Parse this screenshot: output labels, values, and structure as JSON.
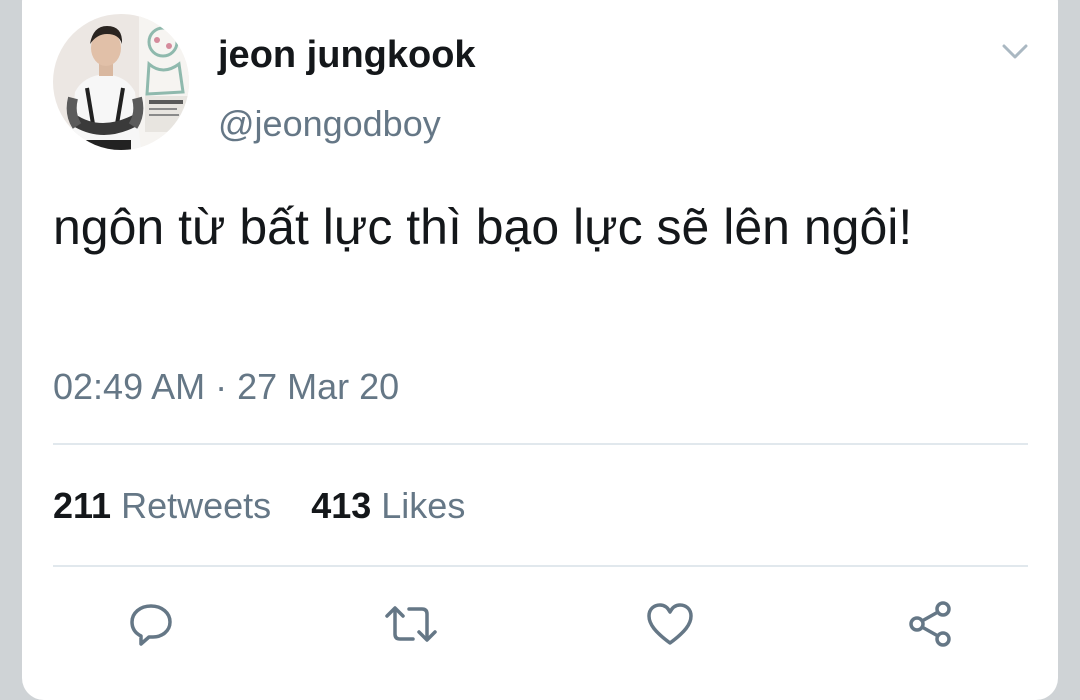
{
  "tweet": {
    "author_name": "jeon jungkook",
    "author_handle": "@jeongodboy",
    "text": "ngôn từ bất lực thì bạo lực sẽ lên ngôi!",
    "timestamp": "02:49 AM · 27 Mar 20"
  },
  "stats": {
    "retweets_count": "211",
    "retweets_label": "Retweets",
    "likes_count": "413",
    "likes_label": "Likes"
  },
  "actions": {
    "reply_icon": "reply-icon",
    "retweet_icon": "retweet-icon",
    "like_icon": "heart-icon",
    "share_icon": "share-icon"
  },
  "colors": {
    "text_primary": "#14171a",
    "text_secondary": "#657786",
    "icon": "#657786",
    "divider": "#e1e8ed"
  }
}
